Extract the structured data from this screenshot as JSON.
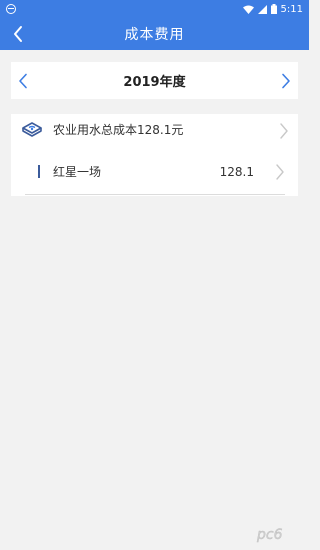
{
  "status_bar": {
    "time": "5:11",
    "icons": [
      "app-icon",
      "wifi-icon",
      "signal-icon",
      "battery-icon"
    ]
  },
  "header": {
    "title": "成本费用",
    "back_icon": "chevron-left-icon"
  },
  "year_selector": {
    "label": "2019年度",
    "prev_icon": "chevron-left-icon",
    "next_icon": "chevron-right-icon"
  },
  "cost_card": {
    "total_label": "农业用水总成本128.1元",
    "total_icon": "water-basin-icon",
    "items": [
      {
        "label": "红星一场",
        "value": "128.1"
      }
    ]
  },
  "watermark": {
    "text": "pc6"
  },
  "colors": {
    "primary": "#3d7de3",
    "background": "#f2f2f2",
    "accent_bar": "#3b5b9b",
    "chevron": "#c8c8c8"
  }
}
